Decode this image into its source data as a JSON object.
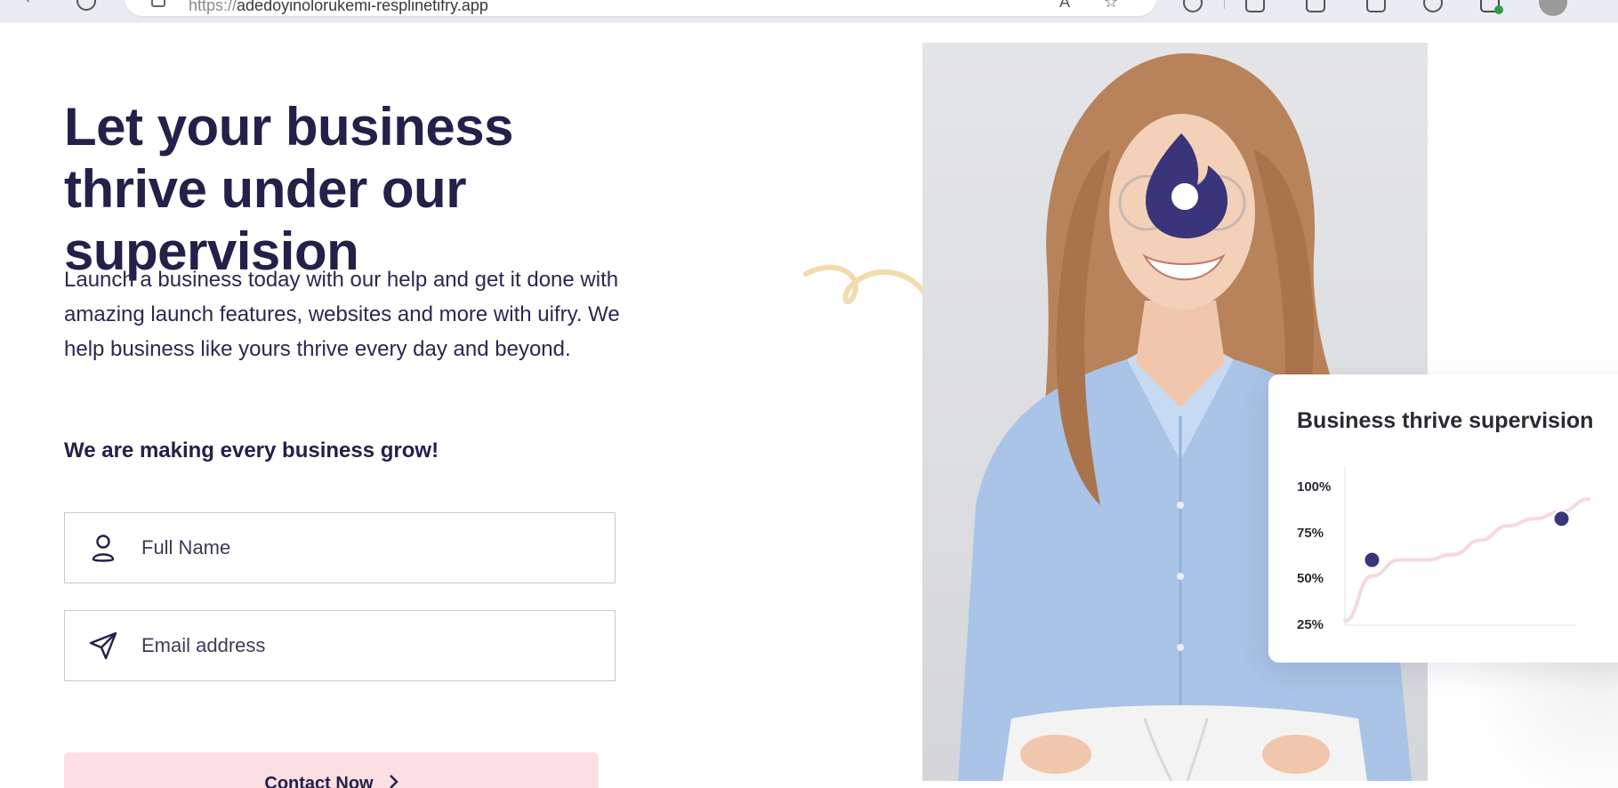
{
  "browser": {
    "url_scheme": "https://",
    "url_host": "adedoyinolorukemi-resplinetifry.app",
    "icons": [
      "back-icon",
      "refresh-icon",
      "site-info-icon",
      "read-aloud-icon",
      "favorite-icon",
      "extensions-icon",
      "split-screen-icon",
      "favorites-bar-icon",
      "collections-icon",
      "browser-essentials-icon",
      "copilot-icon",
      "profile-avatar"
    ]
  },
  "hero": {
    "title": "Let your business thrive under our supervision",
    "description": "Launch a business today with our help and get it done with amazing launch features, websites and more with uifry. We help business like yours thrive every day and beyond.",
    "tagline": "We are making every business grow!"
  },
  "form": {
    "name_placeholder": "Full Name",
    "name_icon": "user-icon",
    "email_placeholder": "Email address",
    "email_icon": "send-icon",
    "submit_label": "Contact Now",
    "submit_icon": "chevron-right-icon"
  },
  "card": {
    "title": "Business thrive supervision",
    "y_labels": [
      "100%",
      "75%",
      "50%",
      "25%"
    ]
  },
  "chart_data": {
    "type": "line",
    "title": "Business thrive supervision",
    "xlabel": "",
    "ylabel": "",
    "y_ticks": [
      "100%",
      "75%",
      "50%",
      "25%"
    ],
    "ylim": [
      25,
      100
    ],
    "grid": false,
    "series": [
      {
        "values": [
          25,
          50,
          59,
          59,
          62,
          70,
          78,
          82,
          86,
          93
        ]
      }
    ],
    "highlighted_points": [
      {
        "index": 1,
        "value": 59
      },
      {
        "index": 8,
        "value": 82
      }
    ]
  },
  "colors": {
    "heading": "#23204a",
    "accent_navy": "#3a357a",
    "cta_background": "#fbdfe2",
    "line_pink": "#f8d8de",
    "squiggle": "#f2dcae"
  },
  "images": {
    "hero_photo": "woman-smiling-photo",
    "brand_mark": "flame-logo-icon"
  }
}
